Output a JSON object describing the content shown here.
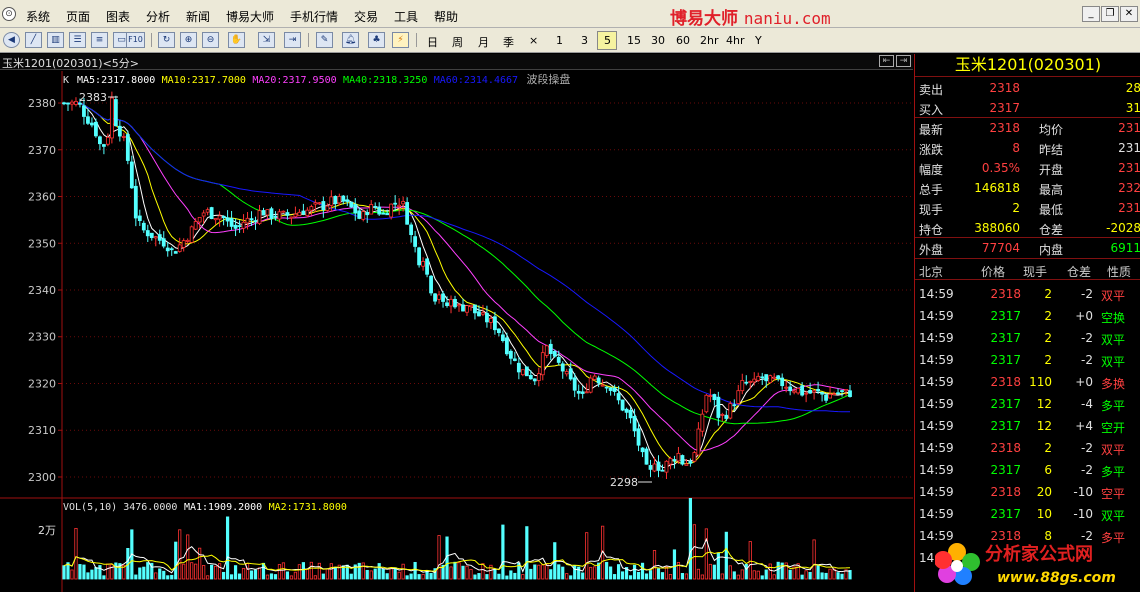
{
  "menu": {
    "items": [
      "系统",
      "页面",
      "图表",
      "分析",
      "新闻",
      "博易大师",
      "手机行情",
      "交易",
      "工具",
      "帮助"
    ],
    "brand_cn": "博易大师",
    "brand_url": "naniu.com"
  },
  "toolbar": {
    "periods": [
      "日",
      "周",
      "月",
      "季",
      "×",
      "1",
      "3",
      "5",
      "15",
      "30",
      "60",
      "2hr",
      "4hr",
      "Y"
    ],
    "active_period": "5"
  },
  "chart_header": {
    "title": "玉米1201(020301)<5分>"
  },
  "chart_data": {
    "type": "candlestick",
    "ma_legend": {
      "prefix": "K",
      "items": [
        {
          "label": "MA5:2317.8000",
          "color": "#ffffff"
        },
        {
          "label": "MA10:2317.7000",
          "color": "#ffff00"
        },
        {
          "label": "MA20:2317.9500",
          "color": "#ff40ff"
        },
        {
          "label": "MA40:2318.3250",
          "color": "#00ff00"
        },
        {
          "label": "MA60:2314.4667",
          "color": "#1818ff"
        }
      ],
      "suffix": "波段操盘"
    },
    "y_ticks": [
      "2380",
      "2370",
      "2360",
      "2350",
      "2340",
      "2330",
      "2320",
      "2310",
      "2300"
    ],
    "y_range": [
      2297,
      2383
    ],
    "high_marker": "2383",
    "low_marker": "2298",
    "price_path": [
      [
        0,
        2380
      ],
      [
        15,
        2380
      ],
      [
        22,
        2377
      ],
      [
        30,
        2375
      ],
      [
        38,
        2370
      ],
      [
        44,
        2373
      ],
      [
        48,
        2381
      ],
      [
        52,
        2376
      ],
      [
        60,
        2372
      ],
      [
        66,
        2366
      ],
      [
        72,
        2356
      ],
      [
        78,
        2353
      ],
      [
        86,
        2352
      ],
      [
        94,
        2351
      ],
      [
        102,
        2350
      ],
      [
        110,
        2348
      ],
      [
        118,
        2350
      ],
      [
        126,
        2352
      ],
      [
        134,
        2355
      ],
      [
        142,
        2357
      ],
      [
        150,
        2356
      ],
      [
        158,
        2356
      ],
      [
        166,
        2354
      ],
      [
        174,
        2353
      ],
      [
        182,
        2355
      ],
      [
        190,
        2355
      ],
      [
        198,
        2357
      ],
      [
        206,
        2356
      ],
      [
        214,
        2356
      ],
      [
        222,
        2356
      ],
      [
        230,
        2356
      ],
      [
        238,
        2357
      ],
      [
        246,
        2357
      ],
      [
        254,
        2358
      ],
      [
        262,
        2358
      ],
      [
        268,
        2359
      ],
      [
        274,
        2359
      ],
      [
        280,
        2359
      ],
      [
        286,
        2358
      ],
      [
        292,
        2357
      ],
      [
        298,
        2355
      ],
      [
        304,
        2357
      ],
      [
        312,
        2358
      ],
      [
        320,
        2356
      ],
      [
        328,
        2358
      ],
      [
        336,
        2359
      ],
      [
        342,
        2358
      ],
      [
        348,
        2352
      ],
      [
        352,
        2350
      ],
      [
        356,
        2346
      ],
      [
        360,
        2348
      ],
      [
        364,
        2344
      ],
      [
        368,
        2341
      ],
      [
        372,
        2338
      ],
      [
        376,
        2340
      ],
      [
        382,
        2336
      ],
      [
        390,
        2338
      ],
      [
        398,
        2336
      ],
      [
        406,
        2337
      ],
      [
        414,
        2335
      ],
      [
        422,
        2334
      ],
      [
        430,
        2333
      ],
      [
        438,
        2331
      ],
      [
        446,
        2327
      ],
      [
        452,
        2325
      ],
      [
        458,
        2323
      ],
      [
        466,
        2322
      ],
      [
        474,
        2321
      ],
      [
        480,
        2325
      ],
      [
        486,
        2328
      ],
      [
        492,
        2325
      ],
      [
        498,
        2324
      ],
      [
        504,
        2322
      ],
      [
        510,
        2320
      ],
      [
        516,
        2318
      ],
      [
        522,
        2317
      ],
      [
        528,
        2321
      ],
      [
        534,
        2322
      ],
      [
        540,
        2320
      ],
      [
        546,
        2320
      ],
      [
        552,
        2318
      ],
      [
        558,
        2316
      ],
      [
        564,
        2314
      ],
      [
        570,
        2312
      ],
      [
        576,
        2308
      ],
      [
        582,
        2304
      ],
      [
        588,
        2300
      ],
      [
        594,
        2304
      ],
      [
        600,
        2301
      ],
      [
        606,
        2303
      ],
      [
        612,
        2304
      ],
      [
        618,
        2305
      ],
      [
        622,
        2303
      ],
      [
        628,
        2303
      ],
      [
        634,
        2305
      ],
      [
        640,
        2312
      ],
      [
        646,
        2318
      ],
      [
        652,
        2317
      ],
      [
        658,
        2313
      ],
      [
        664,
        2313
      ],
      [
        670,
        2315
      ],
      [
        676,
        2317
      ],
      [
        682,
        2320
      ],
      [
        688,
        2320
      ],
      [
        694,
        2320
      ],
      [
        700,
        2322
      ],
      [
        706,
        2320
      ],
      [
        712,
        2321
      ],
      [
        718,
        2320
      ],
      [
        724,
        2320
      ],
      [
        730,
        2319
      ],
      [
        736,
        2319
      ],
      [
        742,
        2318
      ],
      [
        748,
        2318
      ],
      [
        754,
        2318
      ],
      [
        760,
        2318
      ],
      [
        766,
        2317
      ],
      [
        772,
        2318
      ],
      [
        778,
        2318
      ],
      [
        784,
        2318
      ],
      [
        790,
        2318
      ]
    ],
    "volume": {
      "legend": [
        {
          "label": "VOL(5,10) 3476.0000",
          "color": "#e0e0e0"
        },
        {
          "label": "MA1:1909.2000",
          "color": "#ffffff"
        },
        {
          "label": "MA2:1731.8000",
          "color": "#ffff00"
        }
      ],
      "y_tick": "2万"
    }
  },
  "quote": {
    "title": "玉米1201(020301)",
    "rows": [
      {
        "l1": "卖出",
        "v1": "2318",
        "c1": "#ff4040",
        "l2": "",
        "v2": "28",
        "c2": "#ffff00"
      },
      {
        "l1": "买入",
        "v1": "2317",
        "c1": "#ff4040",
        "l2": "",
        "v2": "31",
        "c2": "#ffff00"
      },
      {
        "l1": "最新",
        "v1": "2318",
        "c1": "#ff4040",
        "l2": "均价",
        "v2": "231",
        "c2": "#ff4040"
      },
      {
        "l1": "涨跌",
        "v1": "8",
        "c1": "#ff4040",
        "l2": "昨结",
        "v2": "231",
        "c2": "#e0e0e0"
      },
      {
        "l1": "幅度",
        "v1": "0.35%",
        "c1": "#ff4040",
        "l2": "开盘",
        "v2": "231",
        "c2": "#ff4040"
      },
      {
        "l1": "总手",
        "v1": "146818",
        "c1": "#ffff00",
        "l2": "最高",
        "v2": "232",
        "c2": "#ff4040"
      },
      {
        "l1": "现手",
        "v1": "2",
        "c1": "#ffff00",
        "l2": "最低",
        "v2": "231",
        "c2": "#ff4040"
      },
      {
        "l1": "持仓",
        "v1": "388060",
        "c1": "#ffff00",
        "l2": "仓差",
        "v2": "-2028",
        "c2": "#ffff00"
      },
      {
        "l1": "外盘",
        "v1": "77704",
        "c1": "#ff4040",
        "l2": "内盘",
        "v2": "6911",
        "c2": "#00ff00"
      }
    ],
    "ticks_header": [
      "北京",
      "价格",
      "现手",
      "仓差",
      "性质"
    ],
    "ticks": [
      {
        "t": "14:59",
        "p": "2318",
        "v": "2",
        "d": "-2",
        "k": "双平",
        "kc": "#ff4040"
      },
      {
        "t": "14:59",
        "p": "2317",
        "v": "2",
        "d": "+0",
        "k": "空换",
        "kc": "#00ff00"
      },
      {
        "t": "14:59",
        "p": "2317",
        "v": "2",
        "d": "-2",
        "k": "双平",
        "kc": "#00ff00"
      },
      {
        "t": "14:59",
        "p": "2317",
        "v": "2",
        "d": "-2",
        "k": "双平",
        "kc": "#00ff00"
      },
      {
        "t": "14:59",
        "p": "2318",
        "v": "110",
        "d": "+0",
        "k": "多换",
        "kc": "#ff4040"
      },
      {
        "t": "14:59",
        "p": "2317",
        "v": "12",
        "d": "-4",
        "k": "多平",
        "kc": "#00ff00"
      },
      {
        "t": "14:59",
        "p": "2317",
        "v": "12",
        "d": "+4",
        "k": "空开",
        "kc": "#00ff00"
      },
      {
        "t": "14:59",
        "p": "2318",
        "v": "2",
        "d": "-2",
        "k": "双平",
        "kc": "#ff4040"
      },
      {
        "t": "14:59",
        "p": "2317",
        "v": "6",
        "d": "-2",
        "k": "多平",
        "kc": "#00ff00"
      },
      {
        "t": "14:59",
        "p": "2318",
        "v": "20",
        "d": "-10",
        "k": "空平",
        "kc": "#ff4040"
      },
      {
        "t": "14:59",
        "p": "2317",
        "v": "10",
        "d": "-10",
        "k": "双平",
        "kc": "#00ff00"
      },
      {
        "t": "14:59",
        "p": "2318",
        "v": "8",
        "d": "-2",
        "k": "多平",
        "kc": "#ff4040"
      },
      {
        "t": "14:59",
        "p": "",
        "v": "",
        "d": "",
        "k": "",
        "kc": "#ff4040"
      }
    ]
  },
  "watermark": {
    "name": "分析家公式网",
    "url": "www.88gs.com"
  }
}
